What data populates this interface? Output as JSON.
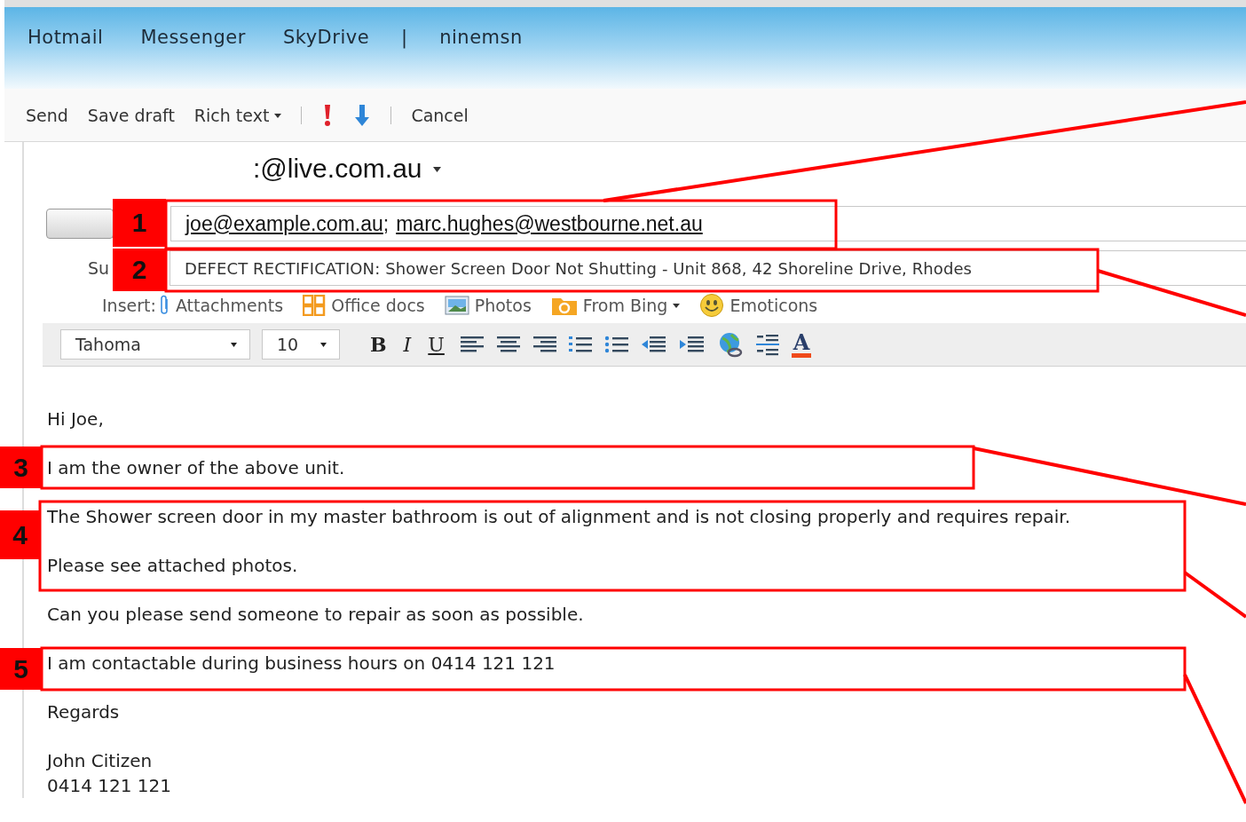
{
  "nav": [
    "Hotmail",
    "Messenger",
    "SkyDrive",
    "|",
    "ninemsn"
  ],
  "toolbar": {
    "send": "Send",
    "save_draft": "Save draft",
    "rich_text": "Rich text",
    "cancel": "Cancel"
  },
  "from": ":@live.com.au",
  "to": [
    "joe@example.com.au",
    "marc.hughes@westbourne.net.au"
  ],
  "to_separator": ";",
  "subject_label": "Su",
  "subject": "DEFECT RECTIFICATION: Shower Screen Door Not Shutting - Unit 868, 42 Shoreline Drive, Rhodes",
  "insert": {
    "label": "Insert:",
    "items": [
      {
        "kind": "attach",
        "label": "Attachments",
        "menu": false
      },
      {
        "kind": "office",
        "label": "Office docs",
        "menu": false
      },
      {
        "kind": "photos",
        "label": "Photos",
        "menu": false
      },
      {
        "kind": "bing",
        "label": "From Bing",
        "menu": true
      },
      {
        "kind": "emoticon",
        "label": "Emoticons",
        "menu": false
      }
    ]
  },
  "format": {
    "font": "Tahoma",
    "size": "10",
    "styles": [
      "B",
      "I",
      "U"
    ],
    "font_color": "A"
  },
  "body": [
    [
      "Hi Joe,"
    ],
    [
      "I am the owner of the above unit."
    ],
    [
      "The Shower screen door in my master bathroom is out of alignment and is not closing properly and requires repair."
    ],
    [
      "Please see attached photos."
    ],
    [
      "Can you please send someone to repair as soon as possible."
    ],
    [
      "I am contactable during business hours on 0414 121 121"
    ],
    [
      "Regards"
    ],
    [
      "John Citizen",
      "0414 121 121"
    ]
  ],
  "annotations": [
    "1",
    "2",
    "3",
    "4",
    "5"
  ]
}
